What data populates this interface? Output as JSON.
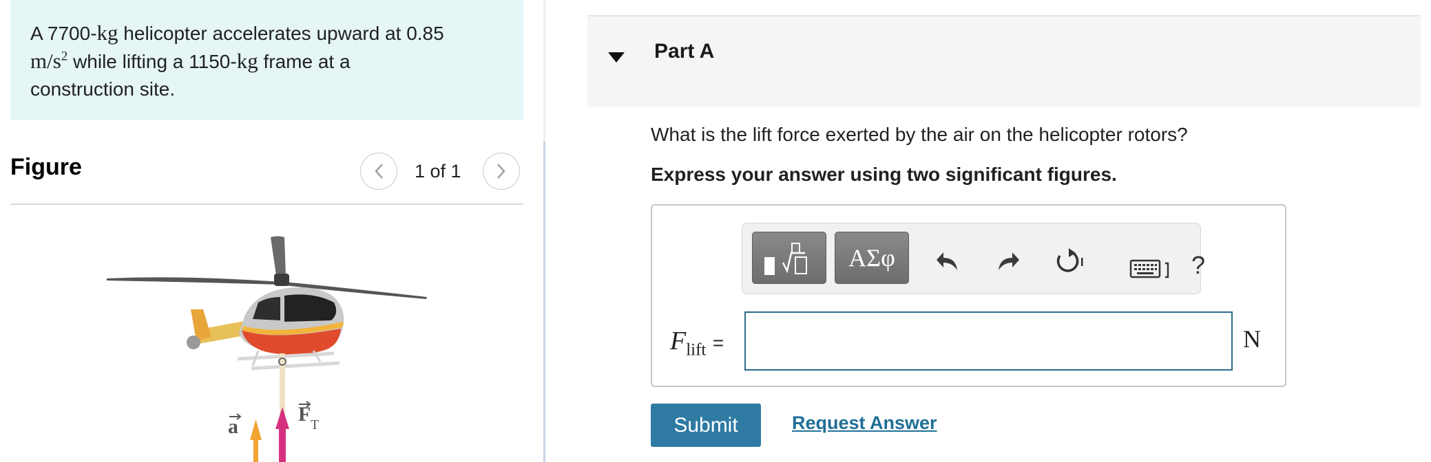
{
  "problem": {
    "t1": "A 7700-",
    "u1": "kg",
    "t2": " helicopter accelerates upward at 0.85",
    "u2": "m/s",
    "u2_exp": "2",
    "t3": " while lifting a 1150-",
    "u3": "kg",
    "t4": " frame at a",
    "t5": "construction site."
  },
  "figure": {
    "title": "Figure",
    "pager": "1 of 1",
    "accel_label": "a",
    "tension_label": "F",
    "tension_sub": "T"
  },
  "part": {
    "title": "Part A",
    "question": "What is the lift force exerted by the air on the helicopter rotors?",
    "instruction": "Express your answer using two significant figures."
  },
  "toolbar": {
    "greek_label": "ΑΣφ",
    "help_label": "?"
  },
  "answer": {
    "var_symbol": "F",
    "var_sub": "lift",
    "equals": "=",
    "value": "",
    "placeholder": "",
    "unit": "N"
  },
  "actions": {
    "submit_label": "Submit",
    "request_label": "Request Answer"
  },
  "colors": {
    "problem_bg": "#e6f6f6",
    "submit_bg": "#2f7aa3",
    "link": "#1f6f97",
    "input_border": "#2b6a8e",
    "tension_arrow": "#d6317f",
    "accel_arrow": "#f2a531"
  }
}
